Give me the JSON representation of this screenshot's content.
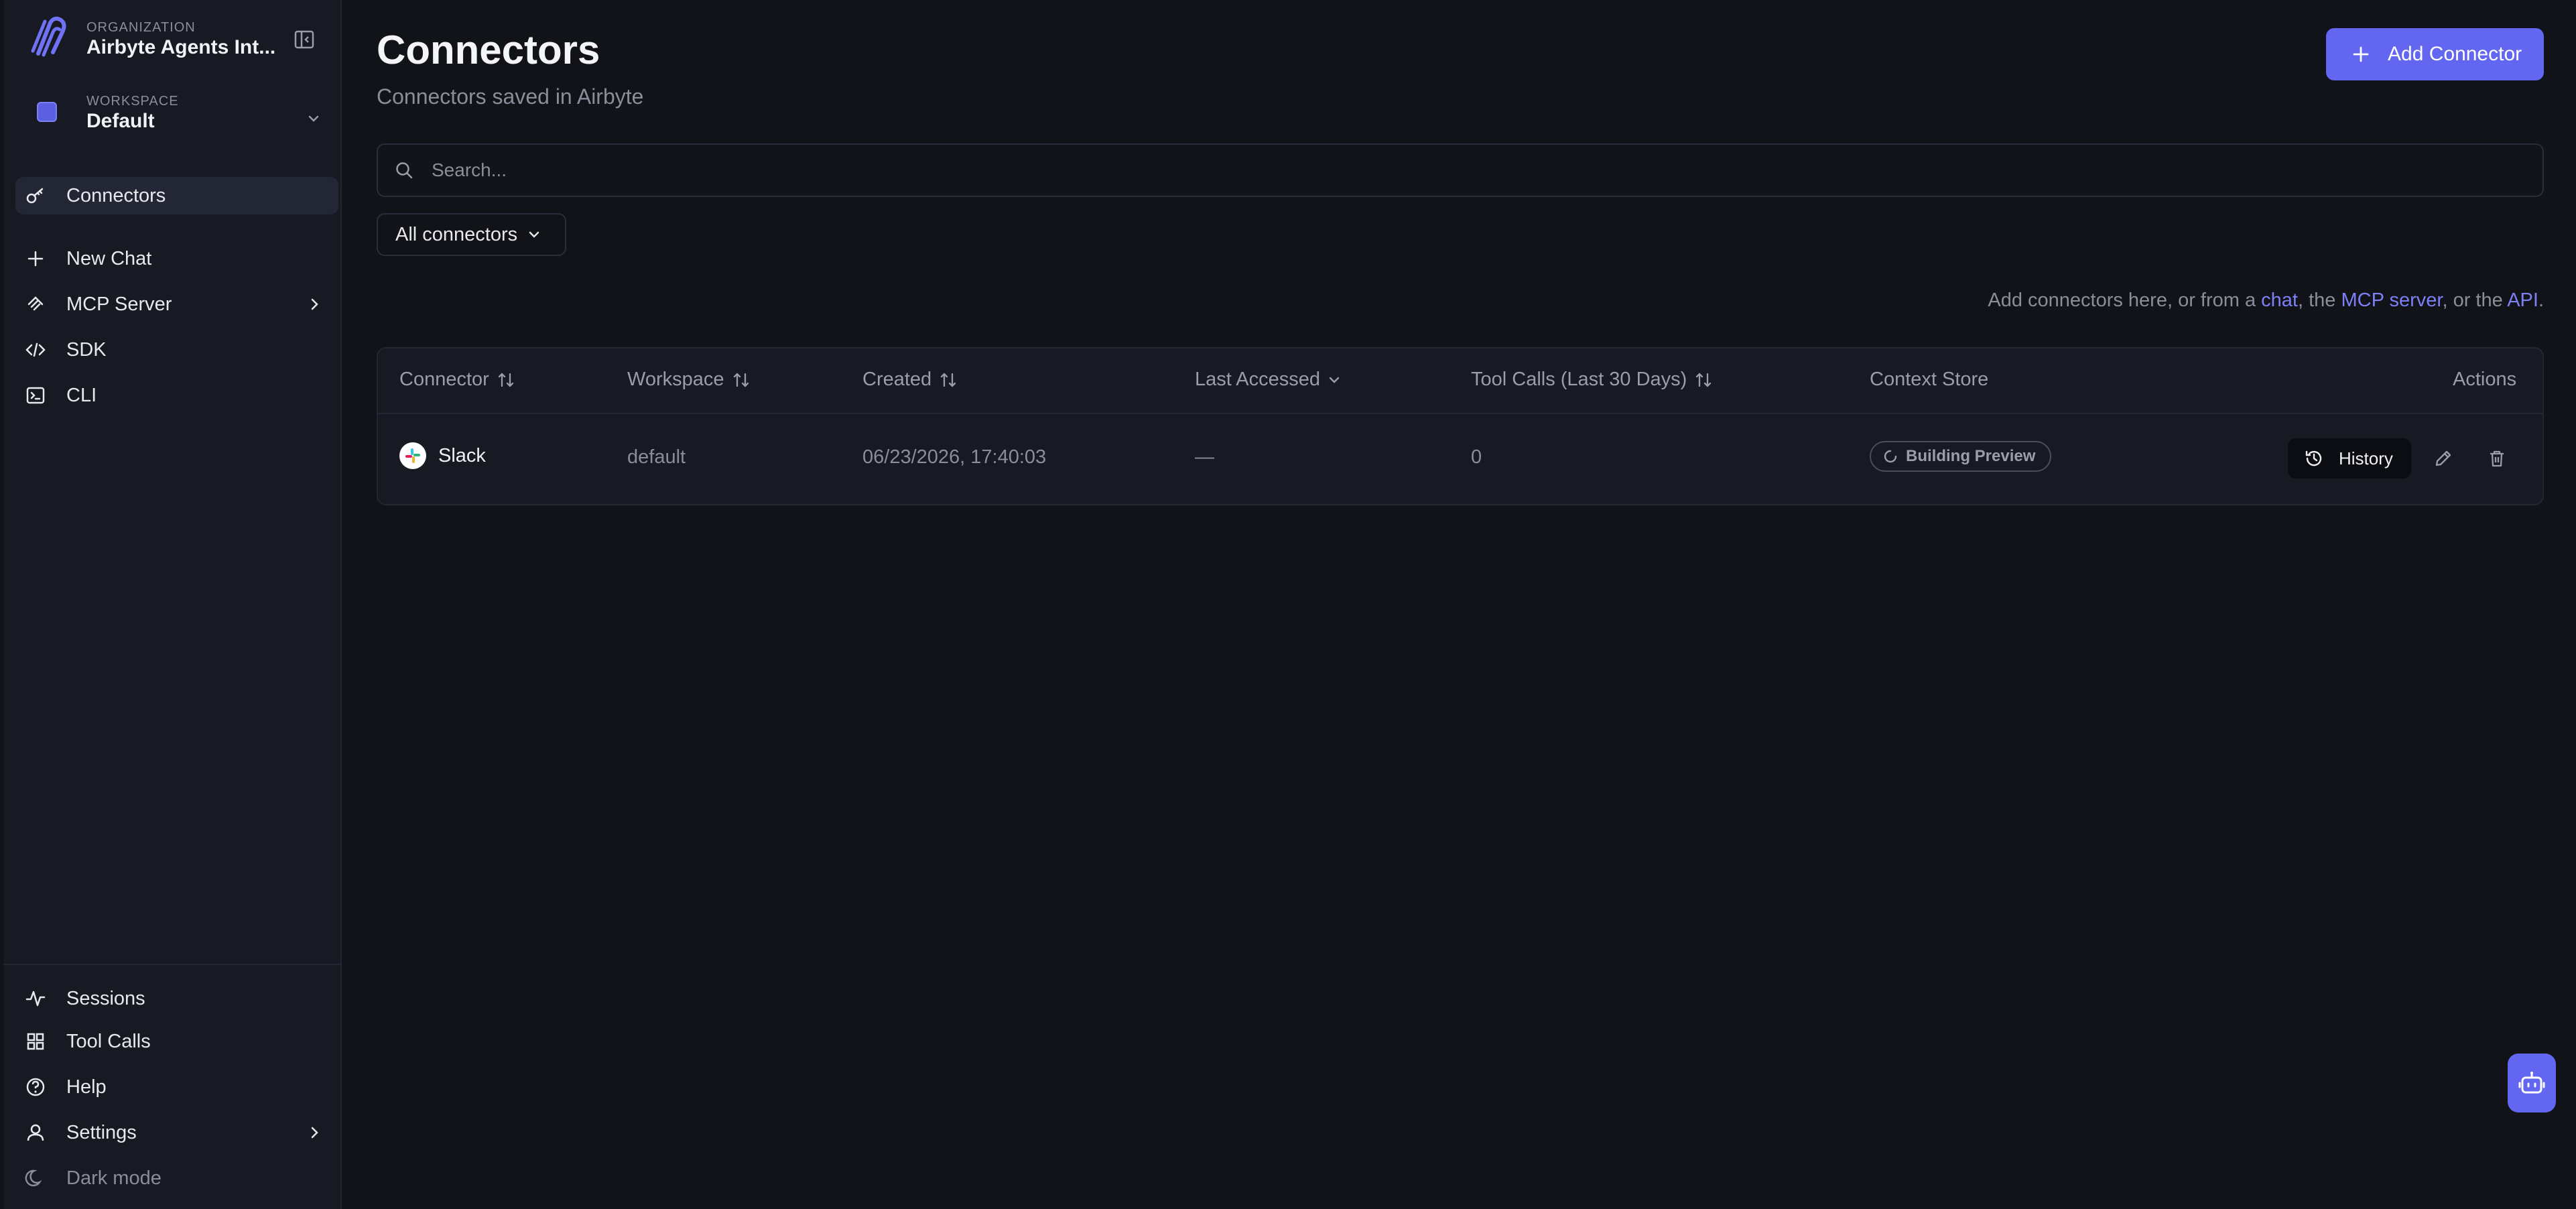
{
  "sidebar": {
    "org_label": "ORGANIZATION",
    "org_name": "Airbyte Agents Int...",
    "workspace_label": "WORKSPACE",
    "workspace_name": "Default",
    "items": [
      {
        "label": "Connectors"
      },
      {
        "label": "New Chat"
      },
      {
        "label": "MCP Server"
      },
      {
        "label": "SDK"
      },
      {
        "label": "CLI"
      }
    ],
    "bottom_items": [
      {
        "label": "Sessions"
      },
      {
        "label": "Tool Calls"
      },
      {
        "label": "Help"
      },
      {
        "label": "Settings"
      },
      {
        "label": "Dark mode"
      }
    ]
  },
  "main": {
    "title": "Connectors",
    "subtitle": "Connectors saved in Airbyte",
    "add_button": "Add Connector",
    "search_placeholder": "Search...",
    "filter_label": "All connectors",
    "hint": {
      "prefix": "Add connectors here, or from a ",
      "link1": "chat",
      "mid1": ", the ",
      "link2": "MCP server",
      "mid2": ", or the ",
      "link3": "API",
      "suffix": "."
    }
  },
  "table": {
    "columns": [
      "Connector",
      "Workspace",
      "Created",
      "Last Accessed",
      "Tool Calls (Last 30 Days)",
      "Context Store",
      "Actions"
    ],
    "rows": [
      {
        "connector": "Slack",
        "workspace": "default",
        "created": "06/23/2026, 17:40:03",
        "last_accessed": "—",
        "tool_calls": "0",
        "context_store": "Building Preview",
        "history_label": "History"
      }
    ]
  },
  "colors": {
    "accent": "#6366f1",
    "background": "#121318",
    "sidebar": "#171923"
  }
}
